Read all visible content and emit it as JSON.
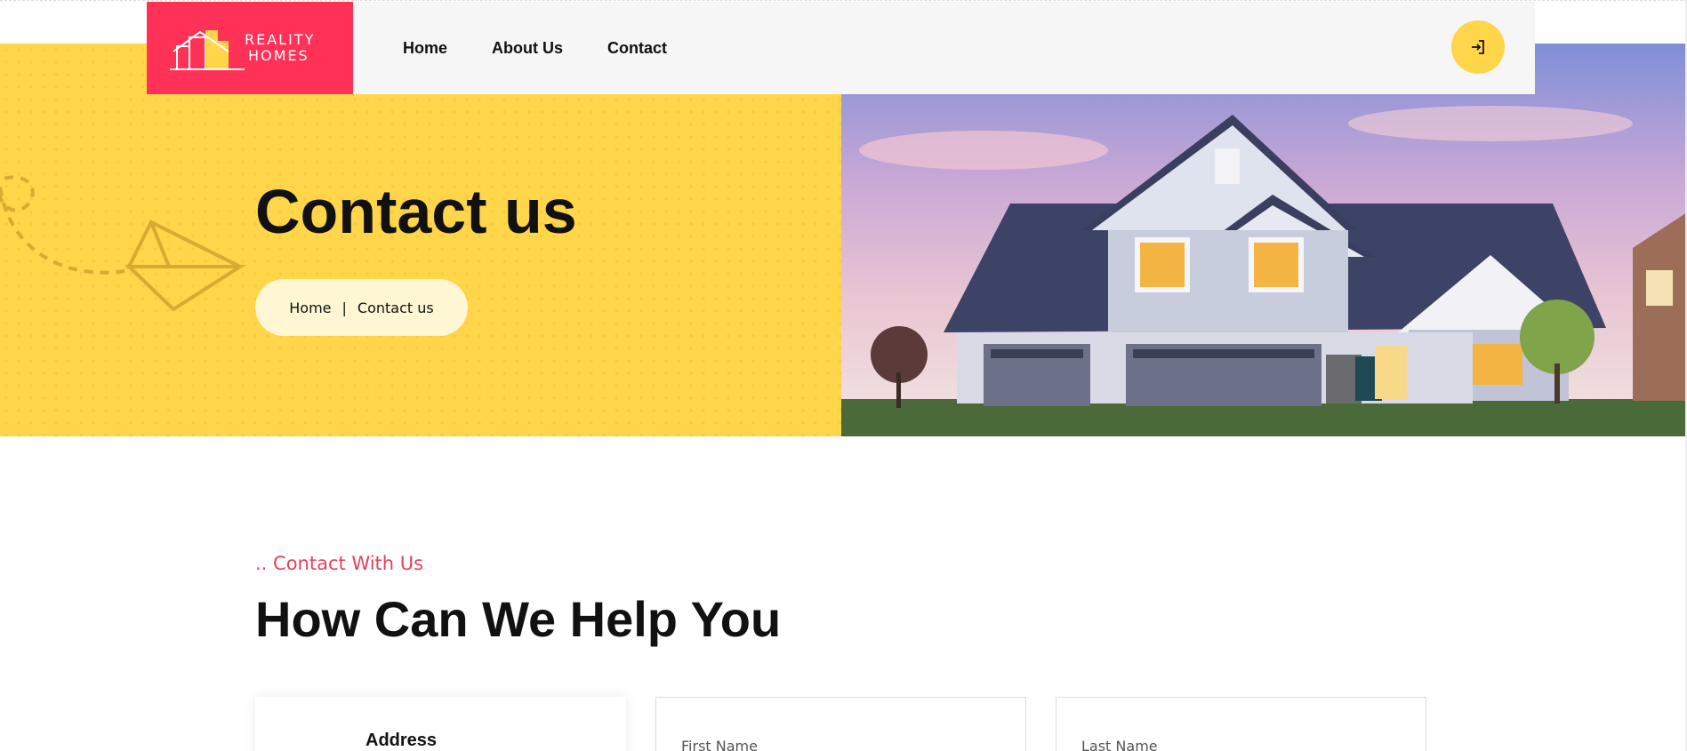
{
  "brand": {
    "logo_line1": "REALITY",
    "logo_line2": "HOMES",
    "logo_color": "#ff3157"
  },
  "nav": {
    "items": [
      {
        "label": "Home"
      },
      {
        "label": "About Us"
      },
      {
        "label": "Contact"
      }
    ],
    "login_icon": "sign-in-icon"
  },
  "hero": {
    "title": "Contact us",
    "breadcrumb": {
      "home": "Home",
      "separator": "|",
      "current": "Contact us"
    },
    "accent_color": "#ffd54a",
    "decoration_icon": "paper-plane-icon"
  },
  "contact_section": {
    "eyebrow": ".. Contact With Us",
    "title": "How Can We Help You",
    "address_card_title": "Address",
    "first_name_placeholder": "First Name",
    "last_name_placeholder": "Last Name",
    "eyebrow_color": "#e83f5b"
  }
}
